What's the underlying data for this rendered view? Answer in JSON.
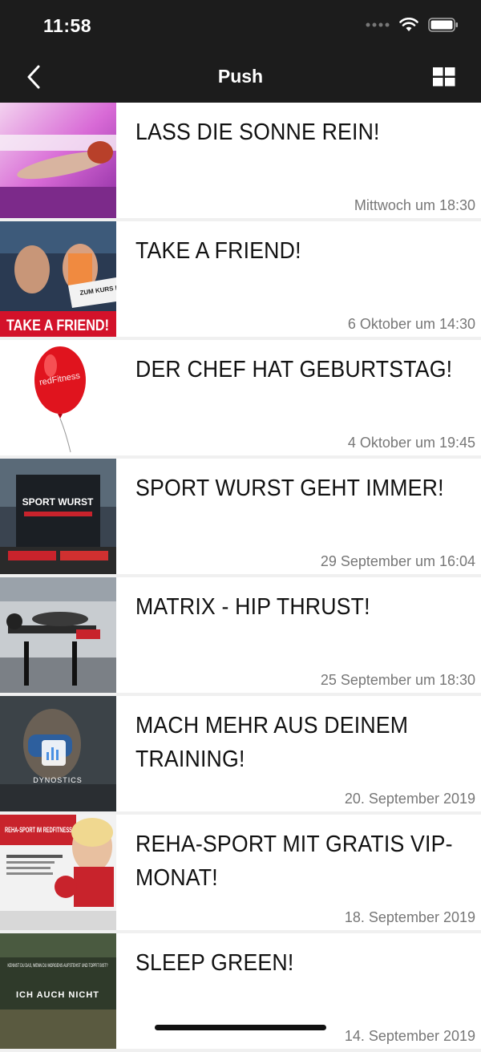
{
  "status_bar": {
    "time": "11:58"
  },
  "nav": {
    "title": "Push"
  },
  "messages": [
    {
      "title": "LASS DIE SONNE REIN!",
      "date": "Mittwoch um 18:30"
    },
    {
      "title": "TAKE A FRIEND!",
      "date": "6 Oktober um 14:30",
      "thumb_text": "TAKE A FRIEND!",
      "thumb_badge": "ZUM KURS DEINER WAHL!"
    },
    {
      "title": "DER CHEF HAT GEBURTSTAG!",
      "date": "4 Oktober um 19:45",
      "thumb_text": "redFitness"
    },
    {
      "title": "SPORT WURST GEHT IMMER!",
      "date": "29 September um 16:04",
      "thumb_text": "SPORT WURST"
    },
    {
      "title": "MATRIX - HIP THRUST!",
      "date": "25 September um 18:30"
    },
    {
      "title": "MACH MEHR AUS DEINEM TRAINING!",
      "date": "20. September 2019",
      "thumb_text": "DYNOSTICS"
    },
    {
      "title": "REHA-SPORT MIT GRATIS VIP-MONAT!",
      "date": "18. September 2019",
      "thumb_text": "REHA-SPORT IM REDFITNESS"
    },
    {
      "title": "SLEEP GREEN!",
      "date": "14. September 2019",
      "thumb_text": "KENNST DU DAS, WENN DU MORGENS AUFSTEHST UND TOPFIT BIST?",
      "thumb_text2": "ICH AUCH NICHT"
    }
  ]
}
